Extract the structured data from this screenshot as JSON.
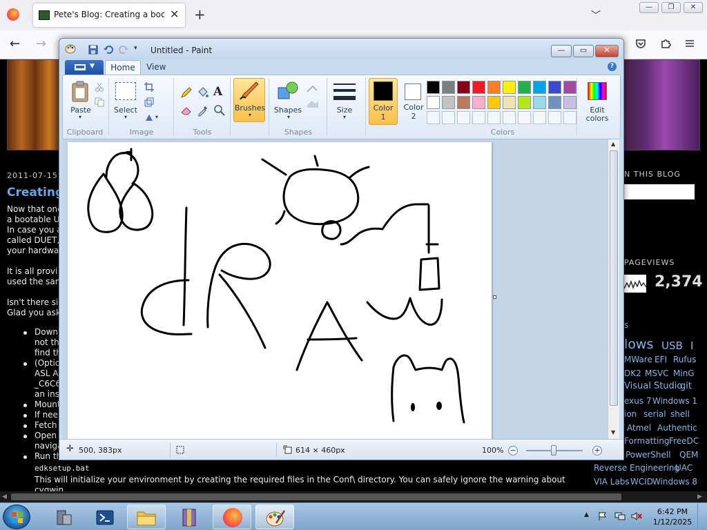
{
  "firefox": {
    "tab_title": "Pete's Blog: Creating a bootable",
    "tab_close": "✕",
    "new_tab": "+",
    "tab_list": "﹀",
    "win_min": "—",
    "win_max": "❐",
    "win_close": "✕",
    "back": "←",
    "forward": "→"
  },
  "blog": {
    "post_date": "2011-07-15",
    "post_title": "Creating",
    "lines": [
      "Now that one",
      "a bootable UE",
      "In case you a",
      "called DUET,",
      "your hardwar",
      "",
      "It is all provi",
      "used the sam",
      "",
      "Isn't there sin",
      "Glad you ask"
    ],
    "bullets": [
      {
        "t": [
          "Downl",
          "not th",
          "find th"
        ]
      },
      {
        "t": [
          "(Optic",
          "ASL A",
          "_C6C6",
          "an ins"
        ]
      },
      {
        "t": [
          "Mount"
        ]
      },
      {
        "t": [
          "If nee"
        ]
      },
      {
        "t": [
          "Fetch"
        ]
      },
      {
        "t": [
          "Open",
          "naviga"
        ]
      },
      {
        "t": [
          "Run th"
        ]
      }
    ],
    "code": "edksetup.bat",
    "after_code_1": "This will initialize your environment by creating the required files in the Conf\\ directory. You can safely ignore the warning about",
    "after_code_2": "cygwin.",
    "sidebar_in_this_blog": "N THIS BLOG",
    "sidebar_pageviews": "PAGEVIEWS",
    "pageviews_count": "2,374",
    "tags": [
      {
        "text": "s",
        "size": "s"
      },
      {
        "text": "lows",
        "size": "xl"
      },
      {
        "text": "USB",
        "size": "l"
      },
      {
        "text": "I",
        "size": "l"
      },
      {
        "text": "MWare",
        "size": "s"
      },
      {
        "text": "EFI",
        "size": "s"
      },
      {
        "text": "Rufus",
        "size": "s"
      },
      {
        "text": "DK2",
        "size": "s"
      },
      {
        "text": "MSVC",
        "size": "s"
      },
      {
        "text": "MinG",
        "size": "s"
      },
      {
        "text": "Visual Studio",
        "size": "m"
      },
      {
        "text": "git",
        "size": "m"
      },
      {
        "text": "exus 7",
        "size": "s"
      },
      {
        "text": "Windows 1",
        "size": "s"
      },
      {
        "text": "ion",
        "size": "s"
      },
      {
        "text": "serial",
        "size": "s"
      },
      {
        "text": "shell",
        "size": "s"
      },
      {
        "text": "Atmel",
        "size": "s"
      },
      {
        "text": "Authentic",
        "size": "s"
      },
      {
        "text": "Formatting",
        "size": "s"
      },
      {
        "text": "FreeDC",
        "size": "s"
      },
      {
        "text": "PowerShell",
        "size": "s"
      },
      {
        "text": "QEM",
        "size": "s"
      },
      {
        "text": "Reverse Engineering",
        "size": "s"
      },
      {
        "text": "UAC",
        "size": "s"
      },
      {
        "text": "VIA Labs",
        "size": "s"
      },
      {
        "text": "WCID",
        "size": "s"
      },
      {
        "text": "Windows 8",
        "size": "s"
      }
    ]
  },
  "paint": {
    "title": "Untitled - Paint",
    "tabs": [
      "Home",
      "View"
    ],
    "groups": {
      "clipboard": "Clipboard",
      "image": "Image",
      "tools": "Tools",
      "shapes": "Shapes",
      "colors": "Colors"
    },
    "buttons": {
      "paste": "Paste",
      "select": "Select",
      "brushes": "Brushes",
      "shapes": "Shapes",
      "size": "Size",
      "color1_a": "Color",
      "color1_b": "1",
      "color2_a": "Color",
      "color2_b": "2",
      "edit_colors_a": "Edit",
      "edit_colors_b": "colors",
      "help": "?"
    },
    "color1": "#000000",
    "color2": "#ffffff",
    "palette_row1": [
      "#000000",
      "#7f7f7f",
      "#880015",
      "#ed1c24",
      "#ff7f27",
      "#fff200",
      "#22b14c",
      "#00a2e8",
      "#3f48cc",
      "#a349a4"
    ],
    "palette_row2": [
      "#ffffff",
      "#c3c3c3",
      "#b97a57",
      "#ffaec9",
      "#ffc90e",
      "#efe4b0",
      "#b5e61d",
      "#99d9ea",
      "#7092be",
      "#c8bfe7"
    ],
    "status": {
      "cursor_pos": "500, 383px",
      "canvas_size": "614 × 460px",
      "zoom": "100%",
      "zoom_out": "−",
      "zoom_in": "+"
    },
    "win_min": "—",
    "win_max": "▭",
    "win_close": "✕"
  },
  "taskbar": {
    "time": "6:42 PM",
    "date": "1/12/2025"
  }
}
